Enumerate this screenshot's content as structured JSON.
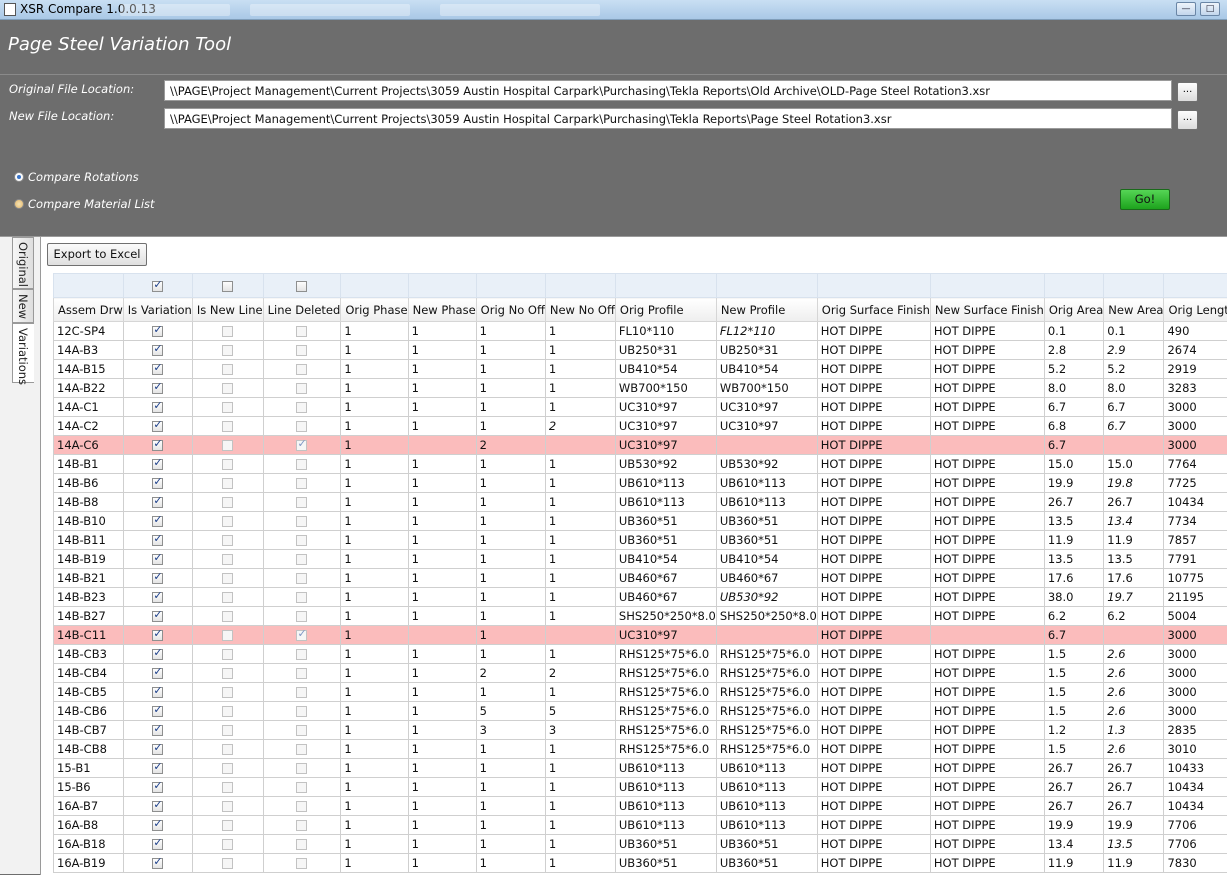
{
  "window": {
    "title": "XSR Compare 1.0.0.13"
  },
  "app": {
    "title": "Page Steel Variation Tool"
  },
  "files": {
    "original_label": "Original File Location:",
    "original_path": "\\\\PAGE\\Project Management\\Current Projects\\3059 Austin Hospital Carpark\\Purchasing\\Tekla Reports\\Old Archive\\OLD-Page Steel Rotation3.xsr",
    "new_label": "New File Location:",
    "new_path": "\\\\PAGE\\Project Management\\Current Projects\\3059 Austin Hospital Carpark\\Purchasing\\Tekla Reports\\Page Steel Rotation3.xsr",
    "browse_label": "..."
  },
  "options": {
    "compare_rotations": "Compare Rotations",
    "compare_material_list": "Compare Material List",
    "selected": "compare_rotations",
    "go_label": "Go!"
  },
  "tabs": [
    "Original",
    "New",
    "Variations"
  ],
  "active_tab": "Variations",
  "toolbar": {
    "export_label": "Export to Excel"
  },
  "columns": [
    "Assem Drw",
    "Is Variation",
    "Is New Line",
    "Line Deleted",
    "Orig Phase",
    "New Phase",
    "Orig No Off",
    "New No Off",
    "Orig Profile",
    "New Profile",
    "Orig Surface Finish",
    "New Surface Finish",
    "Orig Area",
    "New Area",
    "Orig Length"
  ],
  "filter_checks": {
    "is_variation": true,
    "is_new_line": false,
    "line_deleted": false
  },
  "rows": [
    {
      "assem": "12C-SP4",
      "var": true,
      "newline": false,
      "del": false,
      "ophase": "1",
      "nphase": "1",
      "ooff": "1",
      "noff": "1",
      "oprof": "FL10*110",
      "nprof": "FL12*110",
      "osf": "HOT DIPPE",
      "nsf": "HOT DIPPE",
      "oarea": "0.1",
      "narea": "0.1",
      "olen": "490",
      "bold": [
        "nprof"
      ]
    },
    {
      "assem": "14A-B3",
      "var": true,
      "newline": false,
      "del": false,
      "ophase": "1",
      "nphase": "1",
      "ooff": "1",
      "noff": "1",
      "oprof": "UB250*31",
      "nprof": "UB250*31",
      "osf": "HOT DIPPE",
      "nsf": "HOT DIPPE",
      "oarea": "2.8",
      "narea": "2.9",
      "olen": "2674",
      "bold": [
        "narea"
      ]
    },
    {
      "assem": "14A-B15",
      "var": true,
      "newline": false,
      "del": false,
      "ophase": "1",
      "nphase": "1",
      "ooff": "1",
      "noff": "1",
      "oprof": "UB410*54",
      "nprof": "UB410*54",
      "osf": "HOT DIPPE",
      "nsf": "HOT DIPPE",
      "oarea": "5.2",
      "narea": "5.2",
      "olen": "2919",
      "bold": []
    },
    {
      "assem": "14A-B22",
      "var": true,
      "newline": false,
      "del": false,
      "ophase": "1",
      "nphase": "1",
      "ooff": "1",
      "noff": "1",
      "oprof": "WB700*150",
      "nprof": "WB700*150",
      "osf": "HOT DIPPE",
      "nsf": "HOT DIPPE",
      "oarea": "8.0",
      "narea": "8.0",
      "olen": "3283",
      "bold": []
    },
    {
      "assem": "14A-C1",
      "var": true,
      "newline": false,
      "del": false,
      "ophase": "1",
      "nphase": "1",
      "ooff": "1",
      "noff": "1",
      "oprof": "UC310*97",
      "nprof": "UC310*97",
      "osf": "HOT DIPPE",
      "nsf": "HOT DIPPE",
      "oarea": "6.7",
      "narea": "6.7",
      "olen": "3000",
      "bold": []
    },
    {
      "assem": "14A-C2",
      "var": true,
      "newline": false,
      "del": false,
      "ophase": "1",
      "nphase": "1",
      "ooff": "1",
      "noff": "2",
      "oprof": "UC310*97",
      "nprof": "UC310*97",
      "osf": "HOT DIPPE",
      "nsf": "HOT DIPPE",
      "oarea": "6.8",
      "narea": "6.7",
      "olen": "3000",
      "bold": [
        "noff",
        "narea"
      ]
    },
    {
      "assem": "14A-C6",
      "var": true,
      "newline": false,
      "del": true,
      "ophase": "1",
      "nphase": "",
      "ooff": "2",
      "noff": "",
      "oprof": "UC310*97",
      "nprof": "",
      "osf": "HOT DIPPE",
      "nsf": "",
      "oarea": "6.7",
      "narea": "",
      "olen": "3000",
      "bold": []
    },
    {
      "assem": "14B-B1",
      "var": true,
      "newline": false,
      "del": false,
      "ophase": "1",
      "nphase": "1",
      "ooff": "1",
      "noff": "1",
      "oprof": "UB530*92",
      "nprof": "UB530*92",
      "osf": "HOT DIPPE",
      "nsf": "HOT DIPPE",
      "oarea": "15.0",
      "narea": "15.0",
      "olen": "7764",
      "bold": []
    },
    {
      "assem": "14B-B6",
      "var": true,
      "newline": false,
      "del": false,
      "ophase": "1",
      "nphase": "1",
      "ooff": "1",
      "noff": "1",
      "oprof": "UB610*113",
      "nprof": "UB610*113",
      "osf": "HOT DIPPE",
      "nsf": "HOT DIPPE",
      "oarea": "19.9",
      "narea": "19.8",
      "olen": "7725",
      "bold": [
        "narea"
      ]
    },
    {
      "assem": "14B-B8",
      "var": true,
      "newline": false,
      "del": false,
      "ophase": "1",
      "nphase": "1",
      "ooff": "1",
      "noff": "1",
      "oprof": "UB610*113",
      "nprof": "UB610*113",
      "osf": "HOT DIPPE",
      "nsf": "HOT DIPPE",
      "oarea": "26.7",
      "narea": "26.7",
      "olen": "10434",
      "bold": []
    },
    {
      "assem": "14B-B10",
      "var": true,
      "newline": false,
      "del": false,
      "ophase": "1",
      "nphase": "1",
      "ooff": "1",
      "noff": "1",
      "oprof": "UB360*51",
      "nprof": "UB360*51",
      "osf": "HOT DIPPE",
      "nsf": "HOT DIPPE",
      "oarea": "13.5",
      "narea": "13.4",
      "olen": "7734",
      "bold": [
        "narea"
      ]
    },
    {
      "assem": "14B-B11",
      "var": true,
      "newline": false,
      "del": false,
      "ophase": "1",
      "nphase": "1",
      "ooff": "1",
      "noff": "1",
      "oprof": "UB360*51",
      "nprof": "UB360*51",
      "osf": "HOT DIPPE",
      "nsf": "HOT DIPPE",
      "oarea": "11.9",
      "narea": "11.9",
      "olen": "7857",
      "bold": []
    },
    {
      "assem": "14B-B19",
      "var": true,
      "newline": false,
      "del": false,
      "ophase": "1",
      "nphase": "1",
      "ooff": "1",
      "noff": "1",
      "oprof": "UB410*54",
      "nprof": "UB410*54",
      "osf": "HOT DIPPE",
      "nsf": "HOT DIPPE",
      "oarea": "13.5",
      "narea": "13.5",
      "olen": "7791",
      "bold": []
    },
    {
      "assem": "14B-B21",
      "var": true,
      "newline": false,
      "del": false,
      "ophase": "1",
      "nphase": "1",
      "ooff": "1",
      "noff": "1",
      "oprof": "UB460*67",
      "nprof": "UB460*67",
      "osf": "HOT DIPPE",
      "nsf": "HOT DIPPE",
      "oarea": "17.6",
      "narea": "17.6",
      "olen": "10775",
      "bold": []
    },
    {
      "assem": "14B-B23",
      "var": true,
      "newline": false,
      "del": false,
      "ophase": "1",
      "nphase": "1",
      "ooff": "1",
      "noff": "1",
      "oprof": "UB460*67",
      "nprof": "UB530*92",
      "osf": "HOT DIPPE",
      "nsf": "HOT DIPPE",
      "oarea": "38.0",
      "narea": "19.7",
      "olen": "21195",
      "bold": [
        "nprof",
        "narea"
      ]
    },
    {
      "assem": "14B-B27",
      "var": true,
      "newline": false,
      "del": false,
      "ophase": "1",
      "nphase": "1",
      "ooff": "1",
      "noff": "1",
      "oprof": "SHS250*250*8.0",
      "nprof": "SHS250*250*8.0",
      "osf": "HOT DIPPE",
      "nsf": "HOT DIPPE",
      "oarea": "6.2",
      "narea": "6.2",
      "olen": "5004",
      "bold": []
    },
    {
      "assem": "14B-C11",
      "var": true,
      "newline": false,
      "del": true,
      "ophase": "1",
      "nphase": "",
      "ooff": "1",
      "noff": "",
      "oprof": "UC310*97",
      "nprof": "",
      "osf": "HOT DIPPE",
      "nsf": "",
      "oarea": "6.7",
      "narea": "",
      "olen": "3000",
      "bold": []
    },
    {
      "assem": "14B-CB3",
      "var": true,
      "newline": false,
      "del": false,
      "ophase": "1",
      "nphase": "1",
      "ooff": "1",
      "noff": "1",
      "oprof": "RHS125*75*6.0",
      "nprof": "RHS125*75*6.0",
      "osf": "HOT DIPPE",
      "nsf": "HOT DIPPE",
      "oarea": "1.5",
      "narea": "2.6",
      "olen": "3000",
      "bold": [
        "narea"
      ]
    },
    {
      "assem": "14B-CB4",
      "var": true,
      "newline": false,
      "del": false,
      "ophase": "1",
      "nphase": "1",
      "ooff": "2",
      "noff": "2",
      "oprof": "RHS125*75*6.0",
      "nprof": "RHS125*75*6.0",
      "osf": "HOT DIPPE",
      "nsf": "HOT DIPPE",
      "oarea": "1.5",
      "narea": "2.6",
      "olen": "3000",
      "bold": [
        "narea"
      ]
    },
    {
      "assem": "14B-CB5",
      "var": true,
      "newline": false,
      "del": false,
      "ophase": "1",
      "nphase": "1",
      "ooff": "1",
      "noff": "1",
      "oprof": "RHS125*75*6.0",
      "nprof": "RHS125*75*6.0",
      "osf": "HOT DIPPE",
      "nsf": "HOT DIPPE",
      "oarea": "1.5",
      "narea": "2.6",
      "olen": "3000",
      "bold": [
        "narea"
      ]
    },
    {
      "assem": "14B-CB6",
      "var": true,
      "newline": false,
      "del": false,
      "ophase": "1",
      "nphase": "1",
      "ooff": "5",
      "noff": "5",
      "oprof": "RHS125*75*6.0",
      "nprof": "RHS125*75*6.0",
      "osf": "HOT DIPPE",
      "nsf": "HOT DIPPE",
      "oarea": "1.5",
      "narea": "2.6",
      "olen": "3000",
      "bold": [
        "narea"
      ]
    },
    {
      "assem": "14B-CB7",
      "var": true,
      "newline": false,
      "del": false,
      "ophase": "1",
      "nphase": "1",
      "ooff": "3",
      "noff": "3",
      "oprof": "RHS125*75*6.0",
      "nprof": "RHS125*75*6.0",
      "osf": "HOT DIPPE",
      "nsf": "HOT DIPPE",
      "oarea": "1.2",
      "narea": "1.3",
      "olen": "2835",
      "bold": [
        "narea"
      ]
    },
    {
      "assem": "14B-CB8",
      "var": true,
      "newline": false,
      "del": false,
      "ophase": "1",
      "nphase": "1",
      "ooff": "1",
      "noff": "1",
      "oprof": "RHS125*75*6.0",
      "nprof": "RHS125*75*6.0",
      "osf": "HOT DIPPE",
      "nsf": "HOT DIPPE",
      "oarea": "1.5",
      "narea": "2.6",
      "olen": "3010",
      "bold": [
        "narea"
      ]
    },
    {
      "assem": "15-B1",
      "var": true,
      "newline": false,
      "del": false,
      "ophase": "1",
      "nphase": "1",
      "ooff": "1",
      "noff": "1",
      "oprof": "UB610*113",
      "nprof": "UB610*113",
      "osf": "HOT DIPPE",
      "nsf": "HOT DIPPE",
      "oarea": "26.7",
      "narea": "26.7",
      "olen": "10433",
      "bold": []
    },
    {
      "assem": "15-B6",
      "var": true,
      "newline": false,
      "del": false,
      "ophase": "1",
      "nphase": "1",
      "ooff": "1",
      "noff": "1",
      "oprof": "UB610*113",
      "nprof": "UB610*113",
      "osf": "HOT DIPPE",
      "nsf": "HOT DIPPE",
      "oarea": "26.7",
      "narea": "26.7",
      "olen": "10434",
      "bold": []
    },
    {
      "assem": "16A-B7",
      "var": true,
      "newline": false,
      "del": false,
      "ophase": "1",
      "nphase": "1",
      "ooff": "1",
      "noff": "1",
      "oprof": "UB610*113",
      "nprof": "UB610*113",
      "osf": "HOT DIPPE",
      "nsf": "HOT DIPPE",
      "oarea": "26.7",
      "narea": "26.7",
      "olen": "10434",
      "bold": []
    },
    {
      "assem": "16A-B8",
      "var": true,
      "newline": false,
      "del": false,
      "ophase": "1",
      "nphase": "1",
      "ooff": "1",
      "noff": "1",
      "oprof": "UB610*113",
      "nprof": "UB610*113",
      "osf": "HOT DIPPE",
      "nsf": "HOT DIPPE",
      "oarea": "19.9",
      "narea": "19.9",
      "olen": "7706",
      "bold": []
    },
    {
      "assem": "16A-B18",
      "var": true,
      "newline": false,
      "del": false,
      "ophase": "1",
      "nphase": "1",
      "ooff": "1",
      "noff": "1",
      "oprof": "UB360*51",
      "nprof": "UB360*51",
      "osf": "HOT DIPPE",
      "nsf": "HOT DIPPE",
      "oarea": "13.4",
      "narea": "13.5",
      "olen": "7706",
      "bold": [
        "narea"
      ]
    },
    {
      "assem": "16A-B19",
      "var": true,
      "newline": false,
      "del": false,
      "ophase": "1",
      "nphase": "1",
      "ooff": "1",
      "noff": "1",
      "oprof": "UB360*51",
      "nprof": "UB360*51",
      "osf": "HOT DIPPE",
      "nsf": "HOT DIPPE",
      "oarea": "11.9",
      "narea": "11.9",
      "olen": "7830",
      "bold": []
    }
  ],
  "colors": {
    "deleted_row": "#fbbcbc",
    "go_button": "#2fbf2f",
    "header_bg": "#6d6d6d"
  }
}
